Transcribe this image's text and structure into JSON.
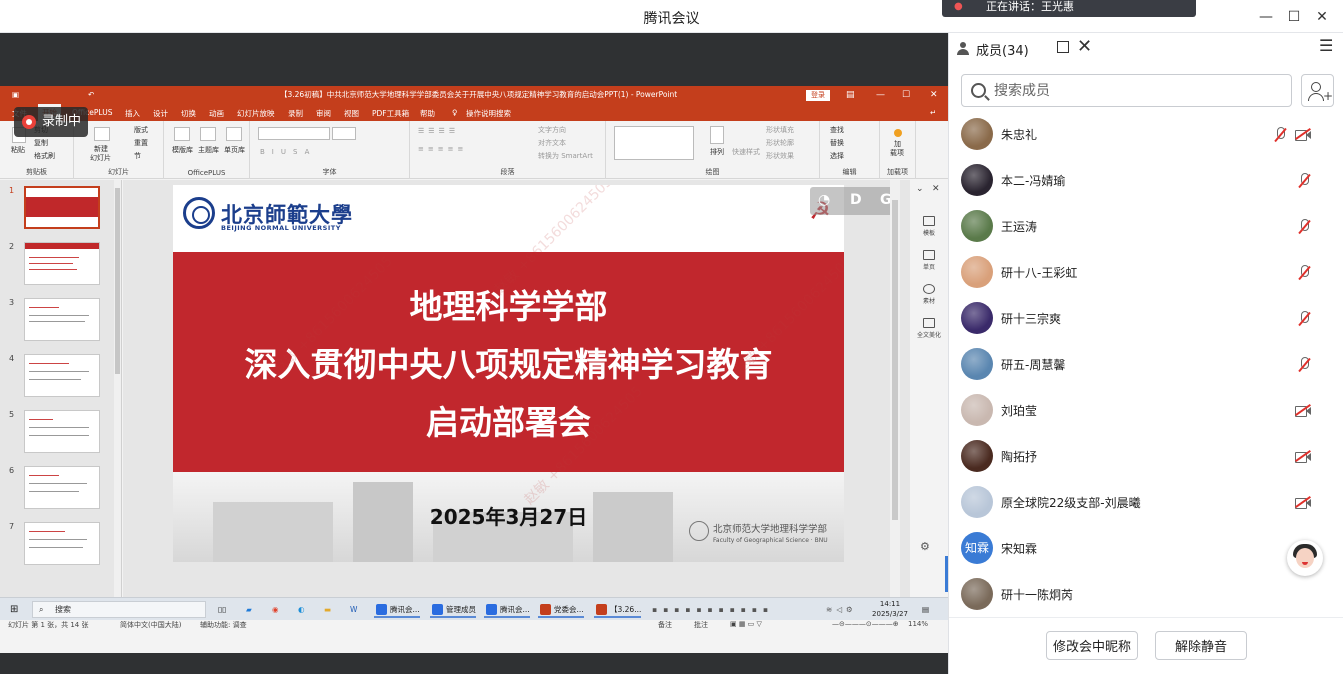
{
  "window": {
    "title": "腾讯会议",
    "speaker_toast": "正在讲话：王光惠",
    "minimize": "—",
    "maximize": "☐",
    "close": "✕"
  },
  "recording": {
    "label": "录制中"
  },
  "ppt": {
    "doc_title": "【3.26初稿】中共北京师范大学地理科学学部委员会关于开展中央八项规定精神学习教育的启动会PPT(1) - PowerPoint",
    "login": "登录",
    "tabs": [
      "文件",
      "开始",
      "OfficePLUS",
      "插入",
      "设计",
      "切换",
      "动画",
      "幻灯片放映",
      "录制",
      "审阅",
      "视图",
      "PDF工具箱",
      "帮助",
      "操作说明搜索"
    ],
    "ribbon": {
      "clipboard": {
        "label": "剪贴板",
        "paste": "粘贴",
        "cut": "剪切",
        "copy": "复制",
        "format_painter": "格式刷"
      },
      "slides": {
        "label": "幻灯片",
        "new_slide": "新建",
        "new_slide2": "幻灯片",
        "layout": "版式",
        "reset": "重置",
        "section": "节"
      },
      "officeplus": {
        "label": "OfficePLUS",
        "a": "模版库",
        "b": "主题库",
        "c": "单页库"
      },
      "font": {
        "label": "字体"
      },
      "paragraph": {
        "label": "段落",
        "text_dir": "文字方向",
        "align_text": "对齐文本",
        "smartart": "转换为 SmartArt"
      },
      "drawing": {
        "label": "绘图",
        "arrange": "排列",
        "quick_styles": "快速样式",
        "fill": "形状填充",
        "outline": "形状轮廓",
        "effects": "形状效果"
      },
      "editing": {
        "label": "编辑",
        "find": "查找",
        "replace": "替换",
        "select": "选择"
      },
      "addins": {
        "label": "加载项",
        "a": "加",
        "b": "载项"
      }
    },
    "thumbnails": [
      "1",
      "2",
      "3",
      "4",
      "5",
      "6",
      "7"
    ],
    "slide": {
      "logo_zh": "北京師範大學",
      "logo_en": "BEIJING NORMAL UNIVERSITY",
      "title_line1": "地理科学学部",
      "title_line2": "深入贯彻中央八项规定精神学习教育",
      "title_line3": "启动部署会",
      "date": "2025年3月27日",
      "geo_zh": "北京师范大学地理科学学部",
      "geo_en": "Faculty of Geographical Science · BNU",
      "party_symbol": "☭",
      "watermark": "赵敏 +8615600624505"
    },
    "overlay": {
      "d": "D",
      "g": "G"
    },
    "side_tools": [
      "模板",
      "单页",
      "素材",
      "全文美化"
    ],
    "status": {
      "slide_info": "幻灯片 第 1 张，共 14 张",
      "lang": "简体中文(中国大陆)",
      "accessibility": "辅助功能: 调查",
      "notes": "备注",
      "comments": "批注",
      "zoom": "114%"
    }
  },
  "taskbar": {
    "search": "搜索",
    "apps": [
      {
        "label": "腾讯会...",
        "color": "#2a6ce0"
      },
      {
        "label": "管理成员",
        "color": "#2a6ce0"
      },
      {
        "label": "腾讯会...",
        "color": "#2a6ce0"
      },
      {
        "label": "党委会...",
        "color": "#c43e1c"
      },
      {
        "label": "【3.26...",
        "color": "#c43e1c"
      }
    ],
    "time": "14:11",
    "date": "2025/3/27"
  },
  "members_panel": {
    "title": "成员(34)",
    "search_placeholder": "搜索成员",
    "members": [
      {
        "name": "朱忠礼",
        "mic_muted": true,
        "cam_off": true,
        "avatar_color": "#8a6a4a"
      },
      {
        "name": "本二-冯婧瑜",
        "mic_muted": true,
        "cam_off": false,
        "avatar_color": "#2a2430"
      },
      {
        "name": "王运涛",
        "mic_muted": true,
        "cam_off": false,
        "avatar_color": "#5a7a4a"
      },
      {
        "name": "研十八-王彩虹",
        "mic_muted": true,
        "cam_off": false,
        "avatar_color": "#d9a07a"
      },
      {
        "name": "研十三宗爽",
        "mic_muted": true,
        "cam_off": false,
        "avatar_color": "#3a2a6a"
      },
      {
        "name": "研五-周慧馨",
        "mic_muted": true,
        "cam_off": false,
        "avatar_color": "#5a86b0"
      },
      {
        "name": "刘珀莹",
        "mic_muted": false,
        "cam_off": true,
        "avatar_color": "#c9b8b0"
      },
      {
        "name": "陶拓抒",
        "mic_muted": false,
        "cam_off": true,
        "avatar_color": "#4a2a20"
      },
      {
        "name": "原全球院22级支部-刘晨曦",
        "mic_muted": false,
        "cam_off": true,
        "avatar_color": "#b8c6d8"
      },
      {
        "name": "宋知霖",
        "mic_muted": false,
        "cam_off": false,
        "avatar_text": "知霖",
        "avatar_color": "#3a7bd5"
      },
      {
        "name": "研十一陈炯芮",
        "mic_muted": false,
        "cam_off": false,
        "avatar_color": "#7a6a5a"
      }
    ],
    "rename_button": "修改会中昵称",
    "unmute_button": "解除静音"
  }
}
